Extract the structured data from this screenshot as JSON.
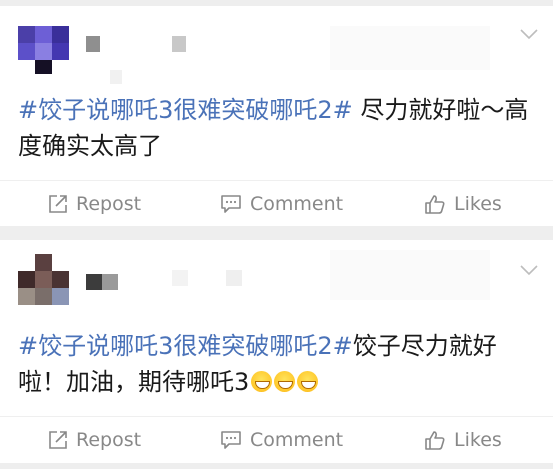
{
  "posts": [
    {
      "content": {
        "hashtag": "#饺子说哪吒3很难突破哪吒2#",
        "text": " 尽力就好啦～高度确实太高了",
        "emojis": []
      },
      "actions": {
        "repost": "Repost",
        "comment": "Comment",
        "likes": "Likes"
      }
    },
    {
      "content": {
        "hashtag": "#饺子说哪吒3很难突破哪吒2#",
        "text": "饺子尽力就好啦！加油，期待哪吒3",
        "emojis": [
          "grin-emoji",
          "grin-emoji",
          "grin-emoji"
        ]
      },
      "actions": {
        "repost": "Repost",
        "comment": "Comment",
        "likes": "Likes"
      }
    }
  ],
  "colors": {
    "hashtag": "#4a72b8",
    "text": "#1a1a1a",
    "action": "#888888",
    "background": "#eeeeee",
    "card": "#ffffff"
  }
}
